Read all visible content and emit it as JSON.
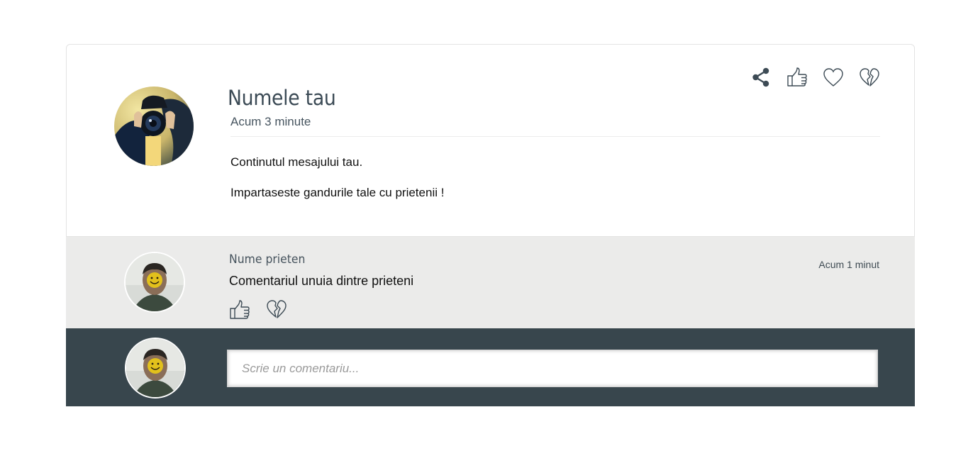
{
  "post": {
    "author_name": "Numele tau",
    "time": "Acum 3 minute",
    "lines": [
      "Continutul mesajului tau.",
      "Impartaseste gandurile tale cu prietenii !"
    ],
    "actions": [
      "share-icon",
      "thumbs-up-icon",
      "heart-icon",
      "broken-heart-icon"
    ]
  },
  "comment": {
    "author_name": "Nume prieten",
    "time": "Acum 1 minut",
    "text": "Comentariul unuia dintre prieteni",
    "actions": [
      "thumbs-up-icon",
      "broken-heart-icon"
    ]
  },
  "compose": {
    "placeholder": "Scrie un comentariu..."
  },
  "colors": {
    "card_background": "#ffffff",
    "comment_background": "#ebebea",
    "compose_background": "#38464d",
    "heading": "#3b4a55",
    "icon": "#3d4b55"
  }
}
